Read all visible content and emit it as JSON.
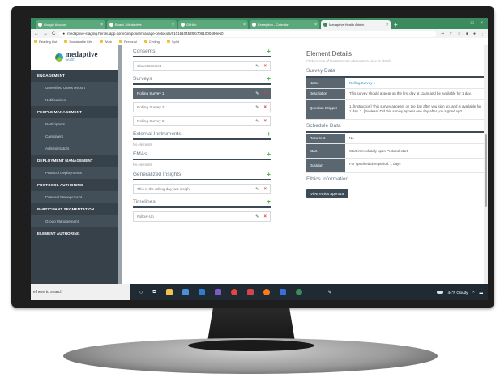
{
  "browser": {
    "tabs": [
      {
        "label": "Google Account",
        "active": false
      },
      {
        "label": "Board - Medaptive",
        "active": false
      },
      {
        "label": "GitHub",
        "active": false
      },
      {
        "label": "Exemption - Calendar",
        "active": false
      },
      {
        "label": "Medaptive Health Admin",
        "active": true
      }
    ],
    "url": "medaptive-staging.herokuapp.com/composer/manage-protocols/6101610453f0b7061000490e60",
    "bookmarks": [
      "Reading List",
      "Sustainable Life",
      "Work",
      "Personal",
      "Cycling",
      "Spirit"
    ]
  },
  "logo": {
    "name": "medaptive",
    "sub": "health"
  },
  "sidebar": [
    {
      "label": "ENGAGEMENT",
      "type": "section"
    },
    {
      "label": "Unverified Users Report",
      "type": "item"
    },
    {
      "label": "Notifications",
      "type": "item"
    },
    {
      "label": "PEOPLE MANAGEMENT",
      "type": "section"
    },
    {
      "label": "Participants",
      "type": "item"
    },
    {
      "label": "Caregivers",
      "type": "item"
    },
    {
      "label": "Administrators",
      "type": "item"
    },
    {
      "label": "DEPLOYMENT MANAGEMENT",
      "type": "section"
    },
    {
      "label": "Protocol Deployments",
      "type": "item"
    },
    {
      "label": "PROTOCOL AUTHORING",
      "type": "section"
    },
    {
      "label": "Protocol Management",
      "type": "item"
    },
    {
      "label": "PARTICIPANT SEGMENTATION",
      "type": "section"
    },
    {
      "label": "Group Management",
      "type": "item"
    },
    {
      "label": "ELEMENT AUTHORING",
      "type": "section"
    }
  ],
  "sections": {
    "consents": {
      "title": "Consents",
      "rows": [
        "Clays Consent"
      ]
    },
    "surveys": {
      "title": "Surveys",
      "rows": [
        "Rolling Survey 1",
        "Rolling Survey 2",
        "Rolling Survey 2"
      ]
    },
    "external": {
      "title": "External Instruments",
      "empty": "No elements"
    },
    "emas": {
      "title": "EMAs",
      "empty": "No elements"
    },
    "insights": {
      "title": "Generalized Insights",
      "rows": [
        "This is the rolling day last insight"
      ]
    },
    "timelines": {
      "title": "Timelines",
      "rows": [
        "Follow-Up"
      ]
    }
  },
  "details": {
    "title": "Element Details",
    "subtitle": "Click on one of the Protocol's elements to view its details",
    "survey_data_title": "Survey Data",
    "name_label": "Name",
    "name_value": "Rolling Survey 1",
    "description_label": "Description",
    "description_value": "This survey should appear on the first day at 11am and be available for 1 day.",
    "snippet_label": "Question Snippet",
    "snippet_value": "1. [Instruction] This survey appears on the day after you sign up, and is available for 1 day. 2. [Boolean] Did this survey appear one day after you signed up?",
    "schedule_title": "Schedule Data",
    "recurrent_label": "Recurrent",
    "recurrent_value": "No",
    "start_label": "Start",
    "start_value": "Start immediately upon Protocol start",
    "duration_label": "Duration",
    "duration_value": "For specified time period: 1 days",
    "ethics_title": "Ethics Information",
    "ethics_button": "View ethics approval"
  },
  "taskbar": {
    "search": "e here to search",
    "weather": "44°F Cloudy"
  }
}
